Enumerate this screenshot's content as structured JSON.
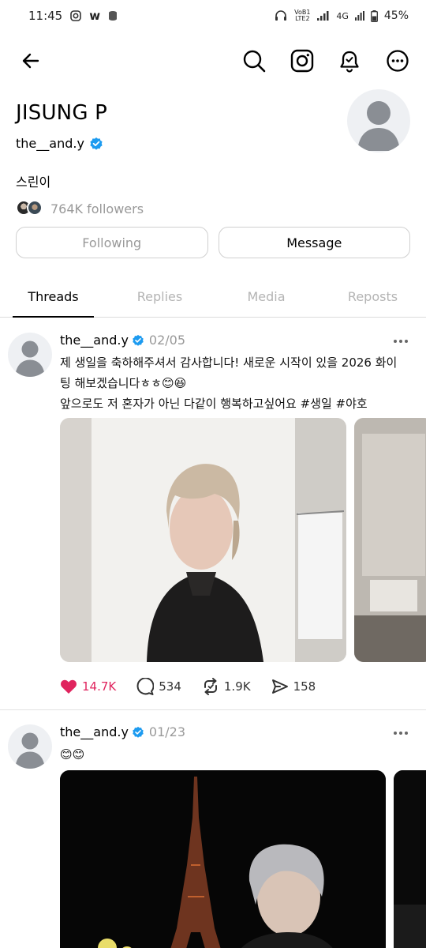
{
  "status_bar": {
    "time": "11:45",
    "network_label": "VoB1 LTE2",
    "signal_type": "4G",
    "battery": "45%"
  },
  "profile": {
    "display_name": "JISUNG P",
    "handle": "the__and.y",
    "bio": "스린이",
    "followers": "764K followers"
  },
  "buttons": {
    "following": "Following",
    "message": "Message"
  },
  "tabs": [
    {
      "label": "Threads",
      "active": true
    },
    {
      "label": "Replies",
      "active": false
    },
    {
      "label": "Media",
      "active": false
    },
    {
      "label": "Reposts",
      "active": false
    }
  ],
  "posts": [
    {
      "username": "the__and.y",
      "date": "02/05",
      "text_lines": [
        "제 생일을 축하해주셔서 감사합니다!  새로운 시작이 있을 2026 화이",
        "팅 해보겠습니다ㅎㅎ😊😆",
        "앞으로도 저 혼자가 아닌 다같이 행복하고싶어요 #생일 #야호"
      ],
      "likes": "14.7K",
      "replies": "534",
      "reposts": "1.9K",
      "shares": "158"
    },
    {
      "username": "the__and.y",
      "date": "01/23",
      "text_lines": [
        "😊😊"
      ]
    }
  ],
  "colors": {
    "verified": "#1d9bf0",
    "like": "#e0245e",
    "muted": "#999999"
  }
}
